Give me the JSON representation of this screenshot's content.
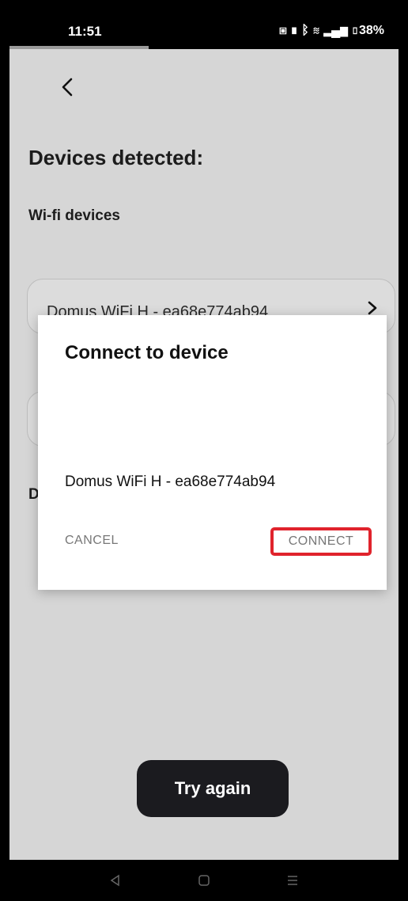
{
  "status_bar": {
    "time": "11:51",
    "icons": [
      "nfc-icon",
      "vibrate-icon",
      "bluetooth-icon",
      "wifi-icon",
      "signal-icon",
      "battery-icon"
    ],
    "battery": "38%"
  },
  "page": {
    "title": "Devices detected:",
    "subtitle": "Wi-fi devices",
    "devices": [
      {
        "label": "Domus WiFi H - ea68e774ab94"
      }
    ],
    "section_second": "D",
    "try_again_label": "Try again"
  },
  "dialog": {
    "title": "Connect to device",
    "message": "Domus WiFi H - ea68e774ab94",
    "cancel_label": "CANCEL",
    "connect_label": "CONNECT",
    "highlight_color": "#e0232c"
  },
  "colors": {
    "background": "#d6d6d6",
    "button_dark": "#1b1b1f"
  },
  "nav_icons": [
    "back-nav-icon",
    "home-nav-icon",
    "recents-nav-icon"
  ]
}
